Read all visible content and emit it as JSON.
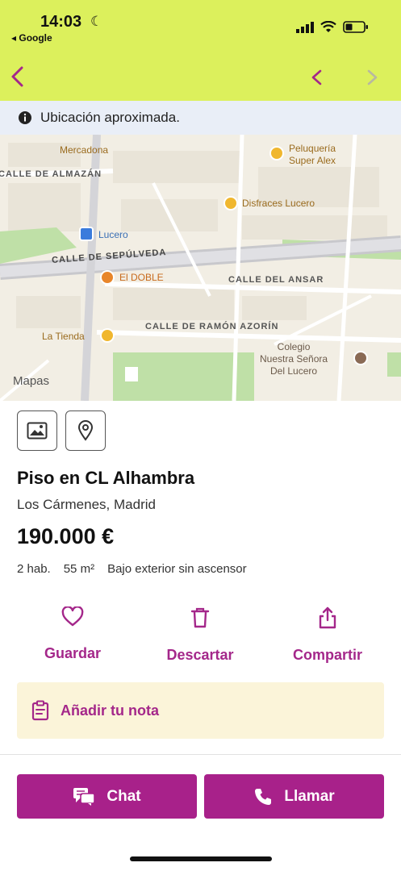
{
  "status_bar": {
    "time": "14:03",
    "back_app": "◂ Google",
    "icons": [
      "signal-icon",
      "wifi-icon",
      "battery-icon",
      "moon-icon"
    ]
  },
  "nav": {
    "icons": [
      "back-arrow-icon",
      "previous-listing-icon",
      "next-listing-icon"
    ]
  },
  "banner": {
    "text": "Ubicación aproximada.",
    "icon": "info-icon"
  },
  "map": {
    "streets": [
      "CALLE DE ALMAZÁN",
      "CALLE DE SEPÚLVEDA",
      "CALLE DEL ANSAR",
      "CALLE DE RAMÓN AZORÍN"
    ],
    "pois": [
      "Mercadona",
      "Peluquería Super Alex",
      "Disfraces Lucero",
      "Lucero",
      "El DOBLE",
      "La Tienda",
      "Colegio Nuestra Señora Del Lucero"
    ],
    "attribution": "Mapas"
  },
  "listing": {
    "title": "Piso en CL Alhambra",
    "location": "Los Cármenes, Madrid",
    "price": "190.000 €",
    "features": [
      "2 hab.",
      "55 m²",
      "Bajo exterior sin ascensor"
    ]
  },
  "actions": {
    "save": "Guardar",
    "discard": "Descartar",
    "share": "Compartir"
  },
  "note": {
    "label": "Añadir tu nota"
  },
  "cta": {
    "chat": "Chat",
    "call": "Llamar"
  },
  "colors": {
    "header_bg": "#dcf05c",
    "accent": "#a8218a",
    "note_bg": "#fbf4d9",
    "banner_bg": "#e9eef7"
  }
}
